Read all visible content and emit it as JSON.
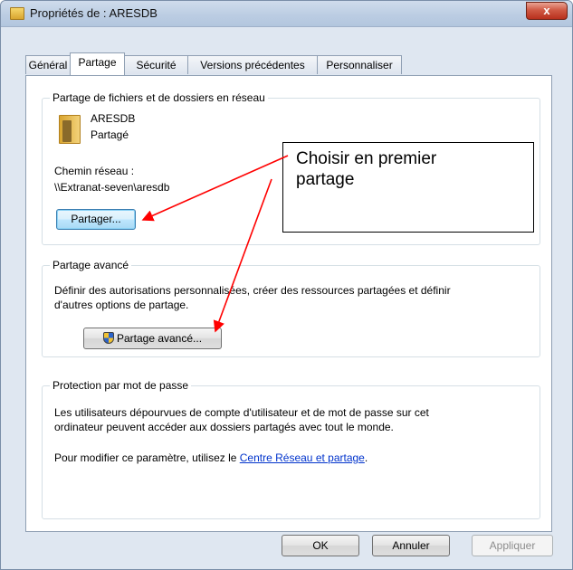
{
  "window": {
    "title": "Propriétés de : ARESDB",
    "close_glyph": "x"
  },
  "tabs": [
    {
      "label": "Général",
      "active": false
    },
    {
      "label": "Partage",
      "active": true
    },
    {
      "label": "Sécurité",
      "active": false
    },
    {
      "label": "Versions précédentes",
      "active": false
    },
    {
      "label": "Personnaliser",
      "active": false
    }
  ],
  "network_sharing": {
    "title": "Partage de fichiers et de dossiers en réseau",
    "folder_name": "ARESDB",
    "folder_status": "Partagé",
    "path_label": "Chemin réseau :",
    "path_value": "\\\\Extranat-seven\\aresdb",
    "share_button": "Partager..."
  },
  "advanced_sharing": {
    "title": "Partage avancé",
    "description_line1": "Définir des autorisations personnalisées, créer des ressources partagées et définir",
    "description_line2": "d'autres options de partage.",
    "button": "Partage avancé..."
  },
  "password_protection": {
    "title": "Protection par mot de passe",
    "description_line1": "Les utilisateurs dépourvues de compte d'utilisateur et de mot de passe sur cet",
    "description_line2": "ordinateur peuvent accéder aux dossiers partagés avec tout le monde.",
    "change_text": "Pour modifier ce paramètre, utilisez le",
    "link_text": "Centre Réseau et partage",
    "after_link": "."
  },
  "footer": {
    "ok": "OK",
    "cancel": "Annuler",
    "apply": "Appliquer"
  },
  "annotation": {
    "line1": "Choisir en premier",
    "line2": "partage",
    "arrow_color": "#ff0000"
  }
}
